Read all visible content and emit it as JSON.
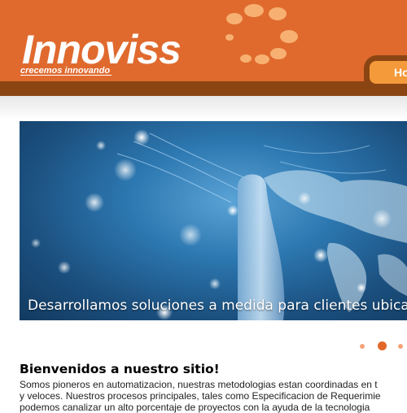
{
  "brand": {
    "name": "Innoviss",
    "tagline": "crecemos innovando",
    "accent_color": "#e06a2e",
    "dark_band_color": "#8b4513"
  },
  "nav": {
    "items": [
      {
        "label": "Ho",
        "active": true
      }
    ]
  },
  "hero": {
    "caption": "Desarrollamos soluciones a medida para clientes ubicados",
    "image_description": "hand touching glowing world map"
  },
  "slider": {
    "slide_count": 3,
    "active_index": 1
  },
  "main": {
    "welcome_title": "Bienvenidos a nuestro sitio!",
    "paragraph_lines": [
      "Somos pioneros en automatizacion, nuestras metodologias estan coordinadas en t",
      "y veloces. Nuestros procesos principales, tales como Especificacion de Requerimie",
      "podemos canalizar un alto porcentaje de proyectos con la ayuda de la tecnologia"
    ]
  }
}
